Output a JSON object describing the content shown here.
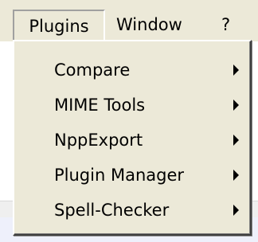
{
  "menubar": {
    "items": [
      {
        "label": "Plugins"
      },
      {
        "label": "Window"
      },
      {
        "label": "?"
      }
    ]
  },
  "dropdown": {
    "items": [
      {
        "label": "Compare"
      },
      {
        "label": "MIME Tools"
      },
      {
        "label": "NppExport"
      },
      {
        "label": "Plugin Manager"
      },
      {
        "label": "Spell-Checker"
      }
    ],
    "submenu_icon": "submenu-arrow-icon"
  },
  "colors": {
    "menu_background": "#ece9d8",
    "text": "#000000",
    "tab_strip": "#eef0fb"
  }
}
